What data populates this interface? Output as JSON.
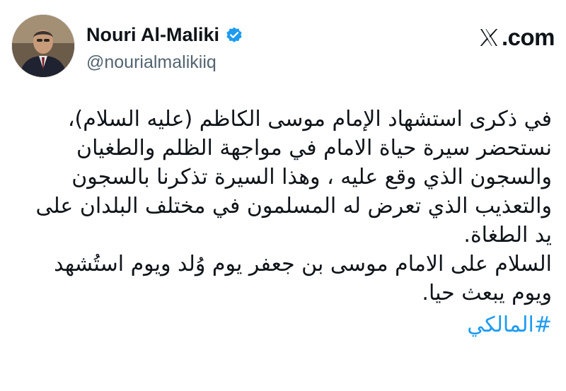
{
  "author": {
    "display_name": "Nouri Al-Maliki",
    "handle": "@nourialmalikiiq",
    "verified_color": "#1d9bf0"
  },
  "brand": {
    "text": ".com",
    "icon": "x-logo-icon"
  },
  "tweet": {
    "paragraph_1": "في ذكرى استشهاد الإمام موسى الكاظم (عليه السلام)، نستحضر سيرة حياة الامام في مواجهة الظلم والطغيان والسجون الذي وقع عليه ، وهذا السيرة تذكرنا بالسجون والتعذيب الذي تعرض له المسلمون في مختلف البلدان على يد الطغاة.",
    "paragraph_2": "السلام على الامام موسى بن جعفر يوم وُلد ويوم استُشهد ويوم يبعث حيا.",
    "hashtag": "#المالكي",
    "hashtag_color": "#1d9bf0"
  }
}
